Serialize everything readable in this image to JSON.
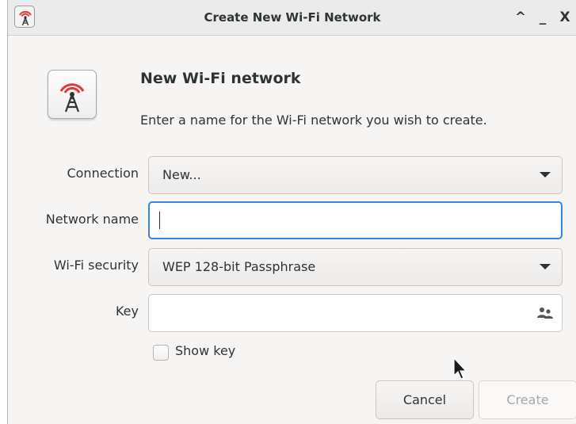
{
  "window": {
    "title": "Create New Wi-Fi Network",
    "controls": {
      "collapse": "^",
      "minimize": "_",
      "close": "X"
    }
  },
  "header": {
    "heading": "New Wi-Fi network",
    "description": "Enter a name for the Wi-Fi network you wish to create.",
    "icon": "wifi-antenna-icon"
  },
  "form": {
    "connection": {
      "label": "Connection",
      "value": "New..."
    },
    "network_name": {
      "label": "Network name",
      "value": "",
      "focused": true
    },
    "security": {
      "label": "Wi-Fi security",
      "value": "WEP 128-bit Passphrase"
    },
    "key": {
      "label": "Key",
      "value": "",
      "icon": "users-icon"
    },
    "show_key": {
      "label": "Show key",
      "checked": false
    }
  },
  "buttons": {
    "cancel": "Cancel",
    "create": "Create",
    "create_enabled": false
  },
  "colors": {
    "focus": "#3584e4",
    "window_bg": "#f6f5f4",
    "text": "#2e3436",
    "disabled_text": "#a8a8a8",
    "antenna_red": "#e0393e"
  }
}
